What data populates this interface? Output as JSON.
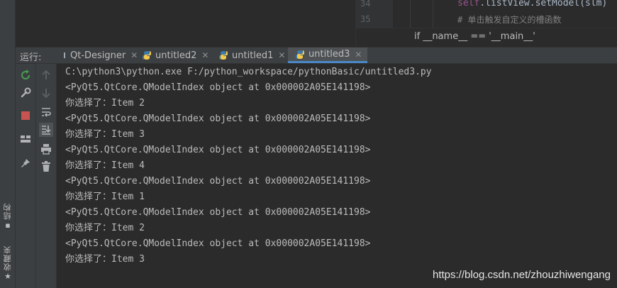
{
  "side_strip": {
    "structure_label": "结构",
    "favorites_label": "收藏夹"
  },
  "editor": {
    "lines": [
      {
        "number": "34",
        "self": "self",
        "rest": ".listView.setModel(slm)"
      },
      {
        "number": "35",
        "comment": "# 单击触发自定义的槽函数"
      }
    ],
    "breadcrumb": "if __name__ == '__main__'"
  },
  "run_panel": {
    "label": "运行:",
    "tabs": [
      {
        "label": "Qt-Designer",
        "active": false
      },
      {
        "label": "untitled2",
        "active": false
      },
      {
        "label": "untitled1",
        "active": false
      },
      {
        "label": "untitled3",
        "active": true
      }
    ],
    "toolbar_icons": [
      "rerun-icon",
      "wrench-icon",
      "stop-icon",
      "layout-icon",
      "pin-icon"
    ],
    "toolbar2_icons": [
      "up-arrow-icon",
      "down-arrow-icon",
      "soft-wrap-icon",
      "scroll-to-end-icon",
      "print-icon",
      "trash-icon"
    ]
  },
  "console": {
    "lines": [
      "C:\\python3\\python.exe F:/python_workspace/pythonBasic/untitled3.py",
      "<PyQt5.QtCore.QModelIndex object at 0x000002A05E141198>",
      "你选择了：Item 2",
      "<PyQt5.QtCore.QModelIndex object at 0x000002A05E141198>",
      "你选择了：Item 3",
      "<PyQt5.QtCore.QModelIndex object at 0x000002A05E141198>",
      "你选择了：Item 4",
      "<PyQt5.QtCore.QModelIndex object at 0x000002A05E141198>",
      "你选择了：Item 1",
      "<PyQt5.QtCore.QModelIndex object at 0x000002A05E141198>",
      "你选择了：Item 2",
      "<PyQt5.QtCore.QModelIndex object at 0x000002A05E141198>",
      "你选择了：Item 3"
    ]
  },
  "watermark": "https://blog.csdn.net/zhouzhiwengang",
  "colors": {
    "background": "#2b2b2b",
    "panel": "#3c3f41",
    "console_text": "#bbbbbb",
    "active_tab_underline": "#4a88c7",
    "rerun_green": "#499c54",
    "stop_red": "#c75450"
  }
}
